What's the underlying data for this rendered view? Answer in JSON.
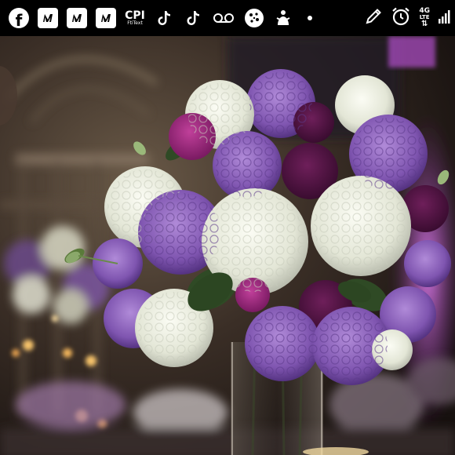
{
  "status_bar": {
    "notification_icons": [
      "facebook-icon",
      "app-n-icon",
      "app-n-icon",
      "app-n-icon",
      "cpi-icon",
      "tiktok-icon",
      "tiktok-icon",
      "voicemail-icon",
      "cookie-icon",
      "snapchat-icon",
      "more-dot-icon"
    ],
    "cpi_text": "CPI",
    "cpi_subtext": "FtiText",
    "right_icons": [
      "pen-icon",
      "alarm-icon",
      "network-icon",
      "signal-icon"
    ],
    "network_type": "4G",
    "network_sub": "LTE"
  },
  "photo": {
    "subject": "wedding-centerpiece",
    "colors": {
      "purple": "#8a5fb8",
      "white": "#eef0e4",
      "burgundy": "#4c1440",
      "magenta": "#a0257a",
      "leaf": "#2f4a25",
      "uplight": "#c05ad8"
    }
  }
}
